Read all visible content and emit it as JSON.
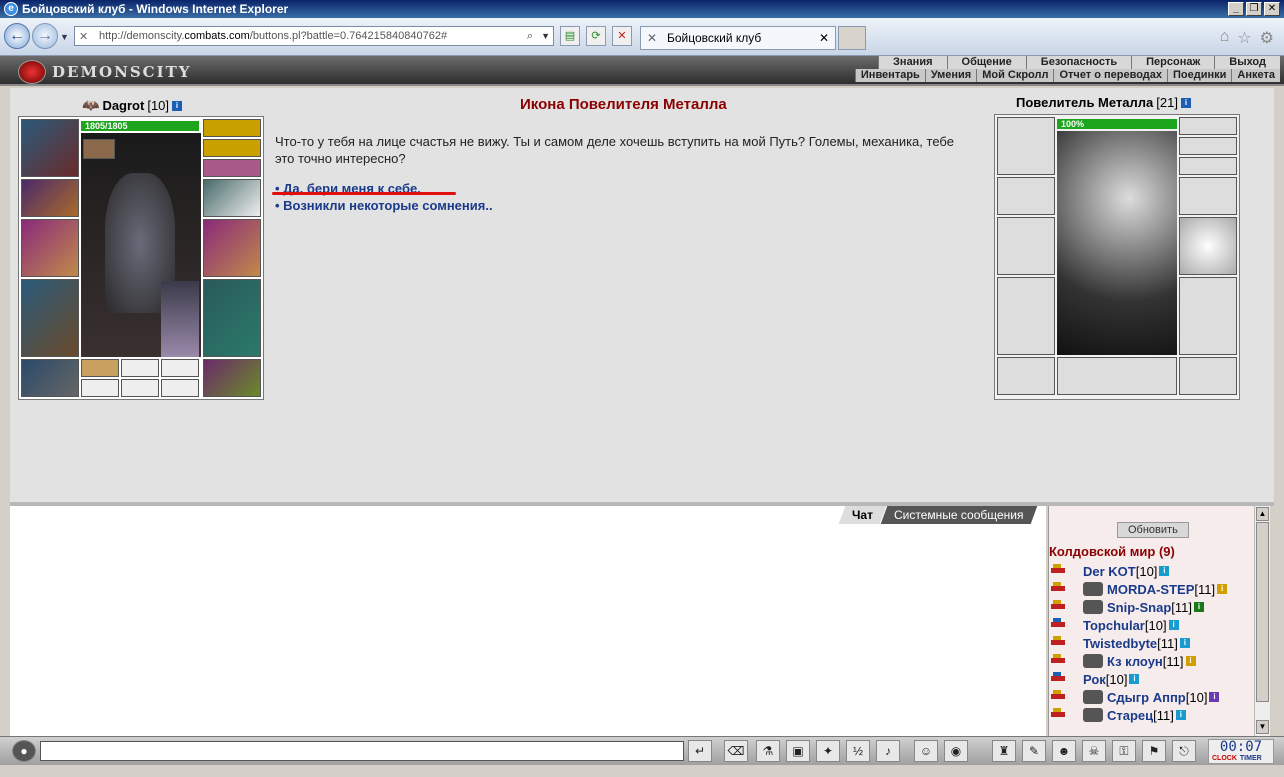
{
  "window": {
    "title": "Бойцовский клуб - Windows Internet Explorer"
  },
  "browser": {
    "url_prefix": "http://demonscity.",
    "url_host": "combats.com",
    "url_suffix": "/buttons.pl?battle=0.764215840840762#",
    "tab_title": "Бойцовский клуб"
  },
  "game": {
    "logo": "DEMONSCITY",
    "menu_top": [
      "Знания",
      "Общение",
      "Безопасность",
      "Персонаж",
      "Выход"
    ],
    "menu_bottom": [
      "Инвентарь",
      "Умения",
      "Мой Скролл",
      "Отчет о переводах",
      "Поединки",
      "Анкета"
    ]
  },
  "player": {
    "name": "Dagrot",
    "level": "[10]",
    "hp": "1805/1805"
  },
  "npc": {
    "name": "Повелитель Металла",
    "level": "[21]",
    "hp": "100%"
  },
  "dialog": {
    "title": "Икона Повелителя Металла",
    "text": "Что-то у тебя на лице счастья не вижу. Ты и самом деле хочешь вступить на мой Путь? Големы, механика, тебе это точно интересно?",
    "option1": "• Да, бери меня к себе.",
    "option2": "• Возникли некоторые сомнения.."
  },
  "chat": {
    "tab_chat": "Чат",
    "tab_system": "Системные сообщения"
  },
  "userlist": {
    "refresh": "Обновить",
    "location": "Колдовской мир (9)",
    "users": [
      {
        "name": "Der KOT",
        "level": "[10]",
        "info_color": "#1a9bd0",
        "icon": "yellow"
      },
      {
        "name": "MORDA-STEP",
        "level": "[11]",
        "info_color": "#d0a000",
        "icon": "yellow",
        "avatar": true
      },
      {
        "name": "Snip-Snap",
        "level": "[11]",
        "info_color": "#1a7a1a",
        "icon": "yellow",
        "avatar": true
      },
      {
        "name": "Topchular",
        "level": "[10]",
        "info_color": "#1a9bd0",
        "icon": "blue"
      },
      {
        "name": "Twistedbyte",
        "level": "[11]",
        "info_color": "#1a9bd0",
        "icon": "yellow"
      },
      {
        "name": "Кз клоун",
        "level": "[11]",
        "info_color": "#d0a000",
        "icon": "yellow",
        "avatar": true
      },
      {
        "name": "Рок",
        "level": "[10]",
        "info_color": "#1a9bd0",
        "icon": "blue"
      },
      {
        "name": "Сдыгр Аппр",
        "level": "[10]",
        "info_color": "#6a3ab0",
        "icon": "yellow",
        "avatar": true
      },
      {
        "name": "Старец",
        "level": "[11]",
        "info_color": "#1a9bd0",
        "icon": "yellow",
        "avatar": true
      }
    ]
  },
  "clock": {
    "time": "00:07",
    "left": "CLOCK",
    "right": "TIMER"
  }
}
